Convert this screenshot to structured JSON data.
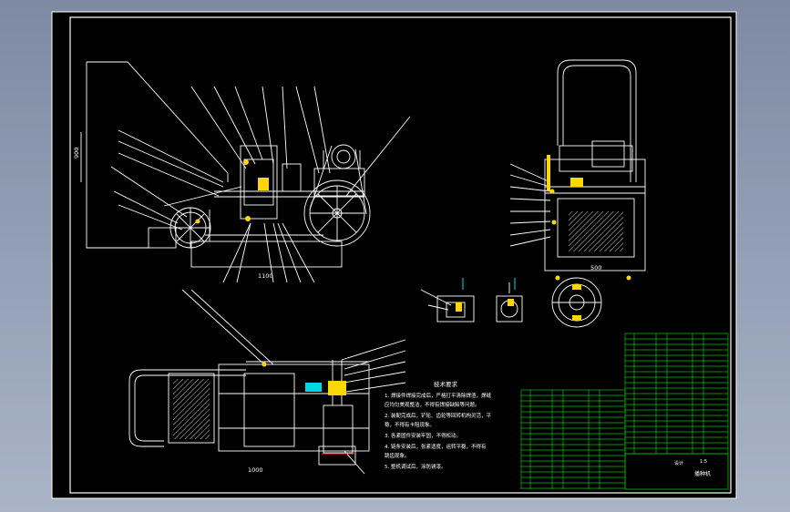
{
  "drawing": {
    "technical_requirements_title": "技术要求",
    "technical_requirements": [
      "1. 焊接件焊接完成后，严格打平清除焊渣，焊缝",
      "   应均匀美观整洁，不得有焊接缺陷等问题。",
      "2. 装配完成后，铲轮、齿轮等回转机构灵活，平",
      "   稳，不得有卡阻现象。",
      "3. 各紧固件安装牢固，不得松动。",
      "4. 链条安装后，张紧适度，运转平稳，不得有",
      "   跳齿现象。",
      "5. 整机调试后，涂防锈漆。"
    ],
    "view_labels": {
      "front_height": "900",
      "front_bottom": "1100",
      "side_bottom": "500",
      "top_bottom": "1000"
    },
    "title_block": {
      "drawing_name": "播种机",
      "company": "设计",
      "scale": "1:5"
    }
  },
  "colors": {
    "background": "#000000",
    "frame": "#ffffff",
    "lines": "#ffffff",
    "leaders": "#ffffff",
    "highlight": "#ffd700",
    "cyan": "#00d8e8",
    "table_grid": "#00c000",
    "red": "#ff3030"
  }
}
